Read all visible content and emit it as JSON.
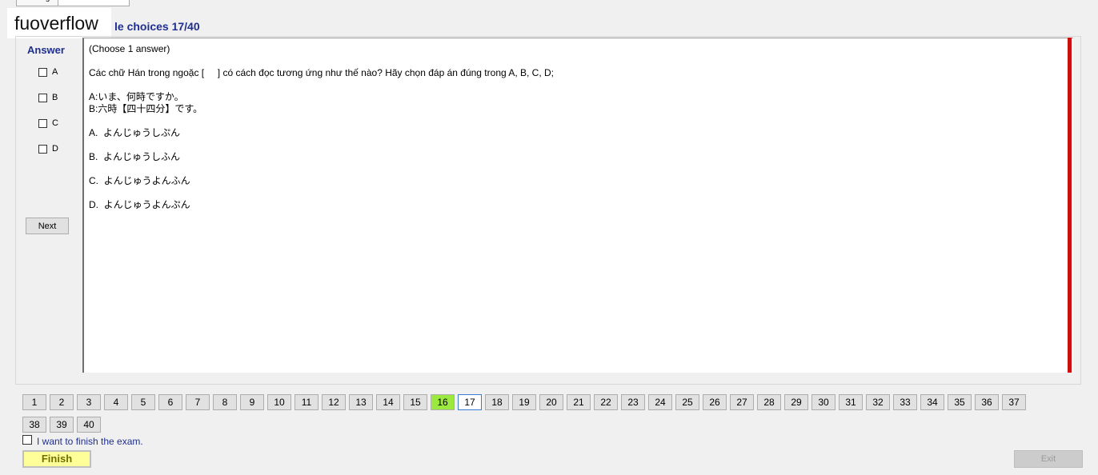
{
  "tabs": [
    "Reading",
    ""
  ],
  "watermark": "fuoverflow",
  "section_title": "le choices 17/40",
  "answer_panel": {
    "title": "Answer",
    "options": [
      "A",
      "B",
      "C",
      "D"
    ],
    "next_label": "Next"
  },
  "question": {
    "instruction": "(Choose 1 answer)",
    "prompt": "Các chữ Hán trong ngoặc [     ] có cách đọc tương ứng như thế nào? Hãy chọn đáp án đúng trong A, B, C, D;",
    "line1": "A:いま、何時ですか。",
    "line2": "B:六時【四十四分】です。",
    "choices": [
      "A.  よんじゅうしぷん",
      "B.  よんじゅうしふん",
      "C.  よんじゅうよんふん",
      "D.  よんじゅうよんぷん"
    ]
  },
  "nav": {
    "questions": [
      "1",
      "2",
      "3",
      "4",
      "5",
      "6",
      "7",
      "8",
      "9",
      "10",
      "11",
      "12",
      "13",
      "14",
      "15",
      "16",
      "17",
      "18",
      "19",
      "20",
      "21",
      "22",
      "23",
      "24",
      "25",
      "26",
      "27",
      "28",
      "29",
      "30",
      "31",
      "32",
      "33",
      "34",
      "35",
      "36",
      "37",
      "38",
      "39",
      "40"
    ],
    "answered": [
      "16"
    ],
    "current": "17"
  },
  "finish_check_label": "I want to finish the exam.",
  "finish_label": "Finish",
  "exit_label": "Exit",
  "colors": {
    "title_blue": "#1f2f8f",
    "answered_green": "#9be93f",
    "red_bar": "#cc1010",
    "finish_yellow": "#ffff99"
  }
}
